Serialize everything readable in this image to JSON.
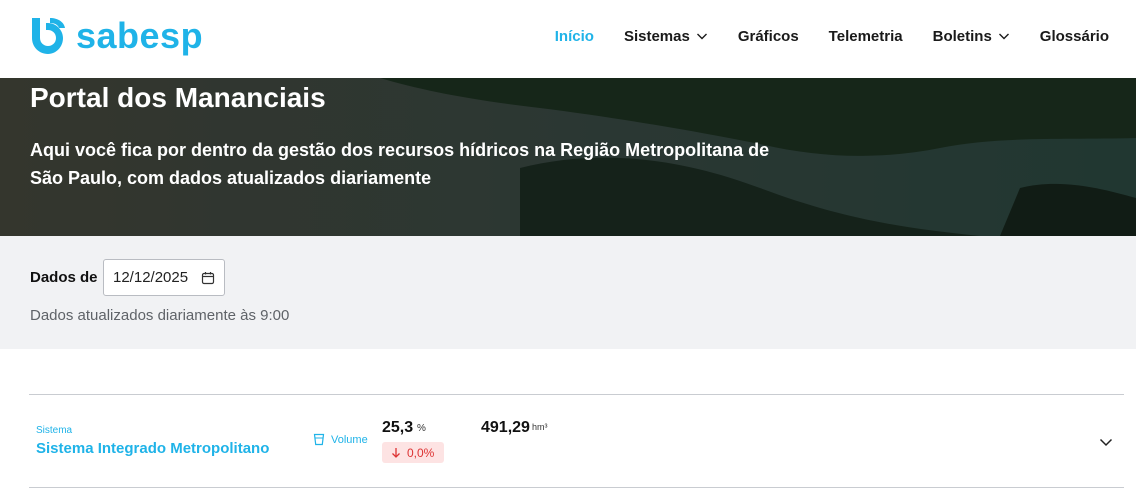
{
  "brand": {
    "name": "sabesp",
    "logo_icon": "sabesp-logo-icon",
    "accent": "#1fb3e8"
  },
  "nav": {
    "items": [
      {
        "label": "Início",
        "active": true,
        "dropdown": false
      },
      {
        "label": "Sistemas",
        "active": false,
        "dropdown": true
      },
      {
        "label": "Gráficos",
        "active": false,
        "dropdown": false
      },
      {
        "label": "Telemetria",
        "active": false,
        "dropdown": false
      },
      {
        "label": "Boletins",
        "active": false,
        "dropdown": true
      },
      {
        "label": "Glossário",
        "active": false,
        "dropdown": false
      }
    ]
  },
  "hero": {
    "title": "Portal dos Mananciais",
    "subtitle": "Aqui você fica por dentro da gestão dos recursos hídricos na Região Metropolitana de São Paulo, com dados atualizados diariamente"
  },
  "filter": {
    "label": "Dados de",
    "date_value": "12/12/2025",
    "date_icon": "calendar-icon",
    "updated_note": "Dados atualizados diariamente às 9:00"
  },
  "system_card": {
    "caption": "Sistema",
    "name": "Sistema Integrado Metropolitano",
    "volume_label": "Volume",
    "volume_icon": "cup-icon",
    "percent_value": "25,3",
    "percent_unit": "%",
    "delta_value": "0,0%",
    "delta_icon": "arrow-down-icon",
    "delta_color": "#d33333",
    "volume_value": "491,29",
    "volume_unit": "hm³",
    "expand_icon": "chevron-down-icon"
  }
}
